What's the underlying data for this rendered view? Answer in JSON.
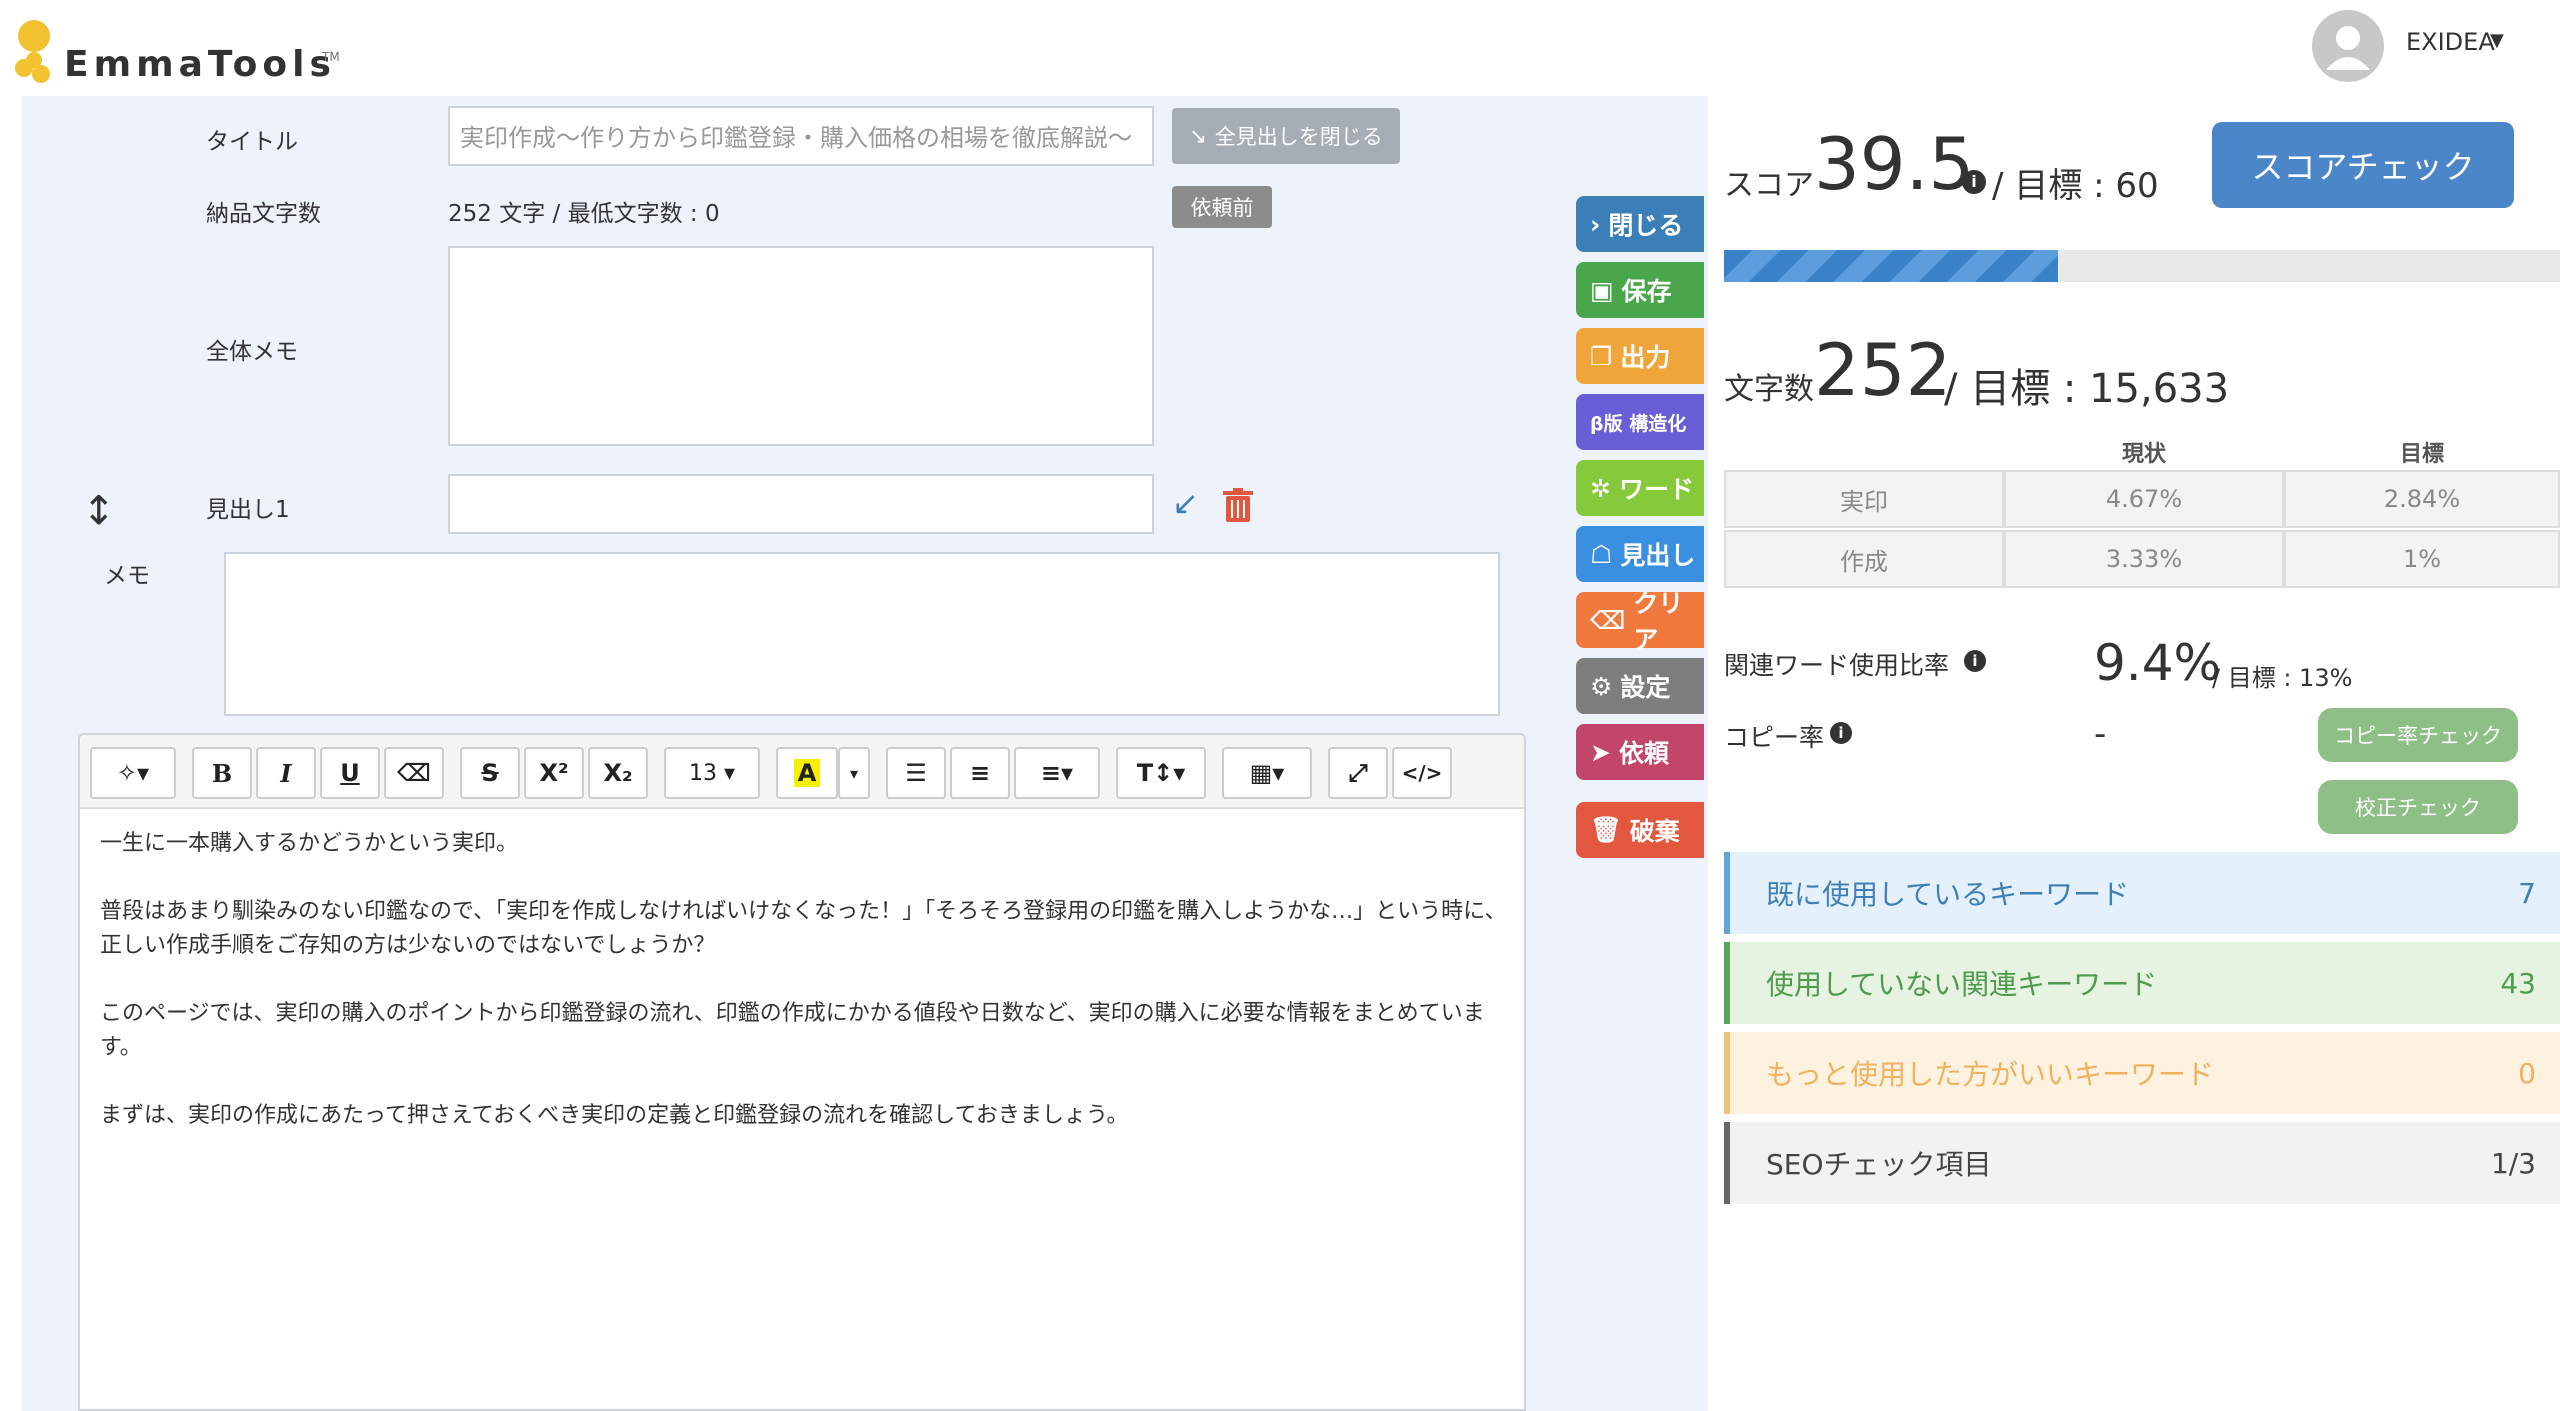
{
  "header": {
    "logo_text": "EmmaTools",
    "logo_tm": "TM",
    "user_name": "EXIDEA"
  },
  "form": {
    "title_label": "タイトル",
    "title_value": "実印作成〜作り方から印鑑登録・購入価格の相場を徹底解説〜",
    "collapse_all_label": "全見出しを閉じる",
    "delivery_count_label": "納品文字数",
    "delivery_count_value": "252 文字 / 最低文字数 : 0",
    "status_badge": "依頼前",
    "memo_all_label": "全体メモ",
    "heading1_label": "見出し1",
    "memo_label": "メモ"
  },
  "toolbar": {
    "font_size": "13"
  },
  "editor": {
    "paragraphs": [
      "一生に一本購入するかどうかという実印。",
      "普段はあまり馴染みのない印鑑なので、「実印を作成しなければいけなくなった！」「そろそろ登録用の印鑑を購入しようかな…」という時に、正しい作成手順をご存知の方は少ないのではないでしょうか？",
      "このページでは、実印の購入のポイントから印鑑登録の流れ、印鑑の作成にかかる値段や日数など、実印の購入に必要な情報をまとめています。",
      "まずは、実印の作成にあたって押さえておくべき実印の定義と印鑑登録の流れを確認しておきましょう。"
    ]
  },
  "side_actions": [
    {
      "label": "閉じる",
      "color": "#3b7fb8",
      "icon": "chevron-right-icon"
    },
    {
      "label": "保存",
      "color": "#4aa64a",
      "icon": "save-icon"
    },
    {
      "label": "出力",
      "color": "#f0a53a",
      "icon": "export-icon"
    },
    {
      "label": "β版 構造化",
      "color": "#6a5ed6",
      "icon": ""
    },
    {
      "label": "ワード",
      "color": "#86c93a",
      "icon": "word-icon"
    },
    {
      "label": "見出し",
      "color": "#3b8fe0",
      "icon": "heading-icon"
    },
    {
      "label": "クリア",
      "color": "#f07a3e",
      "icon": "eraser-icon"
    },
    {
      "label": "設定",
      "color": "#7d7d7d",
      "icon": "gear-icon"
    },
    {
      "label": "依頼",
      "color": "#c2456a",
      "icon": "send-icon"
    },
    {
      "label": "破棄",
      "color": "#e2583e",
      "icon": "trash-icon"
    }
  ],
  "score": {
    "label": "スコア",
    "value": "39.5",
    "target_label": "/ 目標 : 60",
    "check_button": "スコアチェック",
    "progress_fraction": 0.4
  },
  "char_count": {
    "label": "文字数",
    "value": "252",
    "target_label": "/ 目標 : 15,633"
  },
  "keyword_table": {
    "headers": [
      "現状",
      "目標"
    ],
    "rows": [
      {
        "keyword": "実印",
        "current": "4.67%",
        "target": "2.84%"
      },
      {
        "keyword": "作成",
        "current": "3.33%",
        "target": "1%"
      }
    ]
  },
  "related_ratio": {
    "label": "関連ワード使用比率",
    "value": "9.4%",
    "target_label": "/ 目標 : 13%"
  },
  "copy_rate": {
    "label": "コピー率",
    "value": "-",
    "check_button": "コピー率チェック",
    "proof_button": "校正チェック"
  },
  "keyword_sections": [
    {
      "label": "既に使用しているキーワード",
      "count": "7",
      "bg": "#e4f1fc",
      "border": "#5fa4dc",
      "color": "#3f7fb8"
    },
    {
      "label": "使用していない関連キーワード",
      "count": "43",
      "bg": "#e6f3e0",
      "border": "#5aa85a",
      "color": "#4f9a4f"
    },
    {
      "label": "もっと使用した方がいいキーワード",
      "count": "0",
      "bg": "#fdf1e0",
      "border": "#f2c27d",
      "color": "#f0b25e"
    },
    {
      "label": "SEOチェック項目",
      "count": "1/3",
      "bg": "#f2f2f2",
      "border": "#666666",
      "color": "#444444"
    }
  ]
}
